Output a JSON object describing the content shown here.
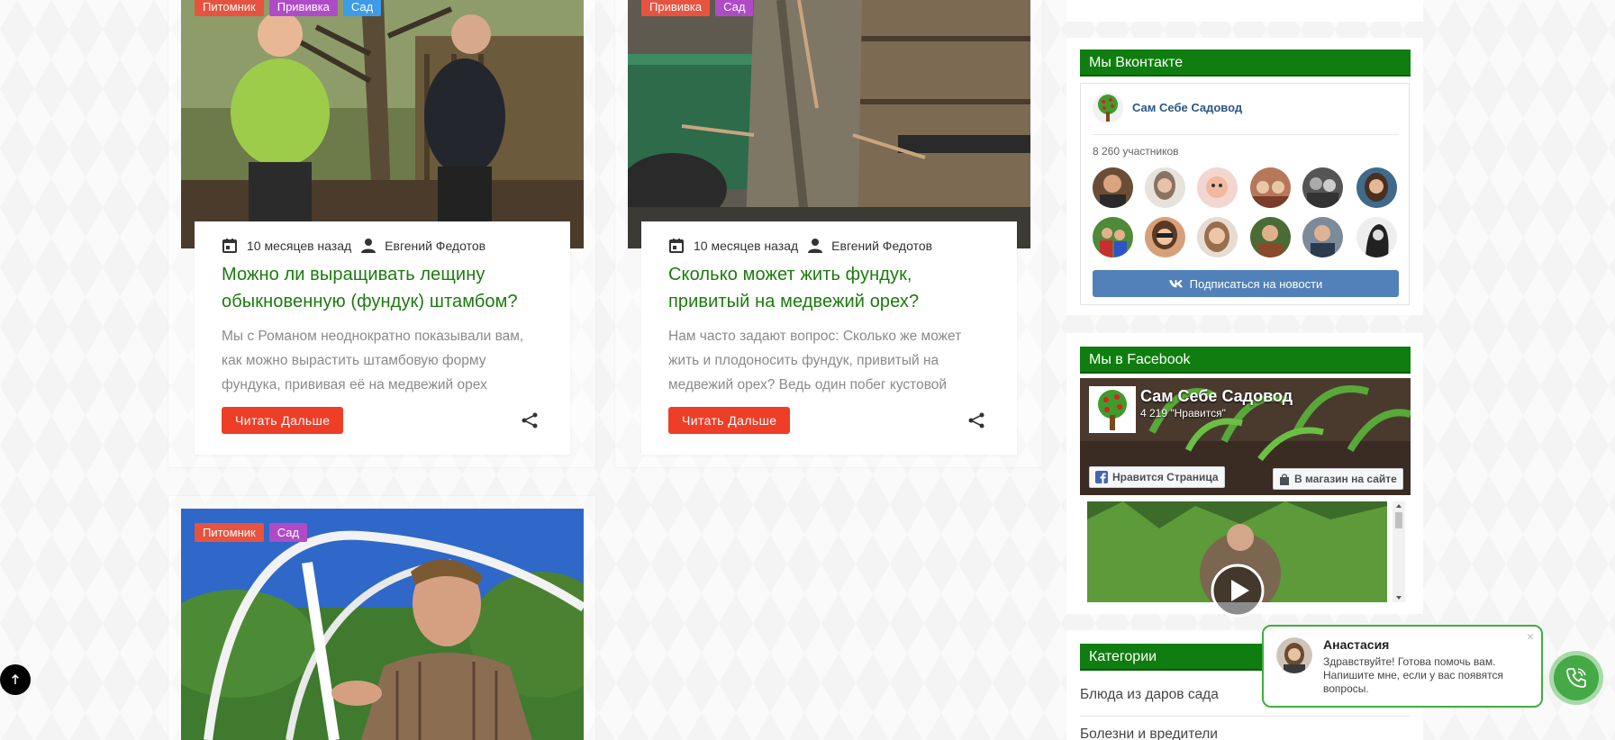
{
  "posts": [
    {
      "tags": [
        "Питомник",
        "Прививка",
        "Сад"
      ],
      "date": "10 месяцев назад",
      "author": "Евгений Федотов",
      "title": "Можно ли выращивать лещину обыкновенную (фундук) штамбом?",
      "excerpt": "Мы с Романом неоднократно показывали вам, как можно вырастить штамбовую форму фундука, прививая её на медвежий орех (лещину турецкую)…",
      "read_more": "Читать Дальше"
    },
    {
      "tags": [
        "Прививка",
        "Сад"
      ],
      "date": "10 месяцев назад",
      "author": "Евгений Федотов",
      "title": "Сколько может жить фундук, привитый на медвежий орех?",
      "excerpt": "Нам часто задают вопрос: Сколько же может жить и плодоносить фундук, привитый на медвежий орех? Ведь один побег кустовой лещины живёт…",
      "read_more": "Читать Дальше"
    },
    {
      "tags": [
        "Питомник",
        "Сад"
      ]
    }
  ],
  "sidebar": {
    "vk": {
      "title": "Мы Вконтакте",
      "group_name": "Сам Себе Садовод",
      "members": "8 260 участников",
      "subscribe": "Подписаться на новости"
    },
    "facebook": {
      "title": "Мы в Facebook",
      "page_name": "Сам Себе Садовод",
      "likes": "4 219 \"Нравится\"",
      "like_button": "Нравится Страница",
      "shop_button": "В магазин на сайте"
    },
    "categories": {
      "title": "Категории",
      "items": [
        "Блюда из даров сада",
        "Болезни и вредители"
      ]
    }
  },
  "chat": {
    "name": "Анастасия",
    "message": "Здравствуйте! Готова помочь вам. Напишите мне, если у вас появятся вопросы."
  },
  "colors": {
    "accent_green": "#0f7d0f",
    "title_green": "#1b7b0d",
    "button_red": "#ee3e27",
    "vk_blue": "#5181b8"
  },
  "icons": {
    "date": "calendar-icon",
    "author": "person-icon",
    "share": "share-icon",
    "scroll_top": "arrow-up-icon",
    "call": "phone-icon"
  }
}
